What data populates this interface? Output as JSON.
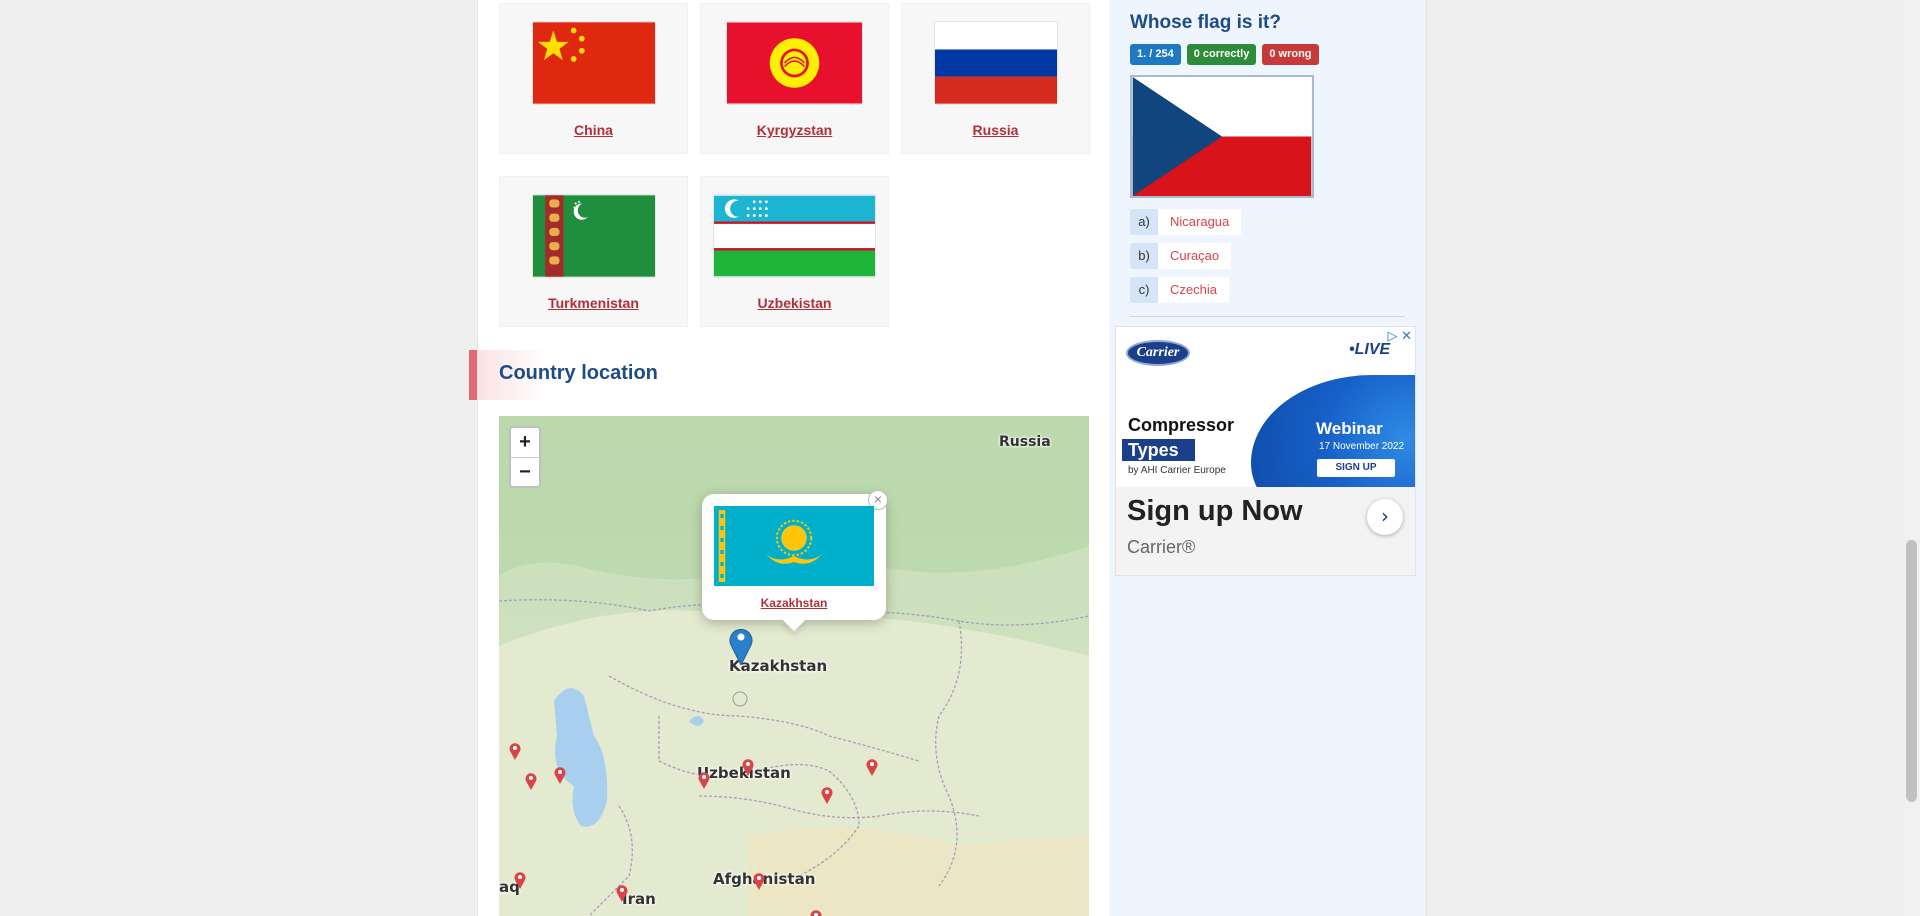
{
  "neighbours": [
    {
      "name": "China"
    },
    {
      "name": "Kyrgyzstan"
    },
    {
      "name": "Russia"
    },
    {
      "name": "Turkmenistan"
    },
    {
      "name": "Uzbekistan"
    }
  ],
  "location_section": {
    "title": "Country location"
  },
  "map": {
    "zoom_in": "+",
    "zoom_out": "−",
    "labels": {
      "russia": "Russia",
      "kazakhstan": "Kazakhstan",
      "uzbekistan": "Uzbekistan",
      "afghanistan": "Afghanistan",
      "iran": "Iran",
      "iraq": "aq"
    },
    "popup": {
      "country": "Kazakhstan",
      "close": "×"
    }
  },
  "quiz": {
    "title": "Whose flag is it?",
    "progress": "1. / 254",
    "correct": "0  correctly",
    "wrong": "0  wrong",
    "answers": [
      {
        "letter": "a)",
        "option": "Nicaragua"
      },
      {
        "letter": "b)",
        "option": "Curaçao"
      },
      {
        "letter": "c)",
        "option": "Czechia"
      }
    ]
  },
  "ad": {
    "logo": "Carrier",
    "live": "•LIVE",
    "headline_1": "Compressor",
    "headline_2": "Types",
    "byline": "by AHI Carrier Europe",
    "webinar": "Webinar",
    "date": "17 November 2022",
    "signup": "SIGN UP",
    "cta": "Sign up Now",
    "brand": "Carrier®",
    "arrow": "›",
    "adchoices": "▷ ✕"
  },
  "colors": {
    "link": "#b0303a",
    "heading": "#1d4c86",
    "marker_red": "#d9434a",
    "marker_blue": "#2a81cb"
  }
}
